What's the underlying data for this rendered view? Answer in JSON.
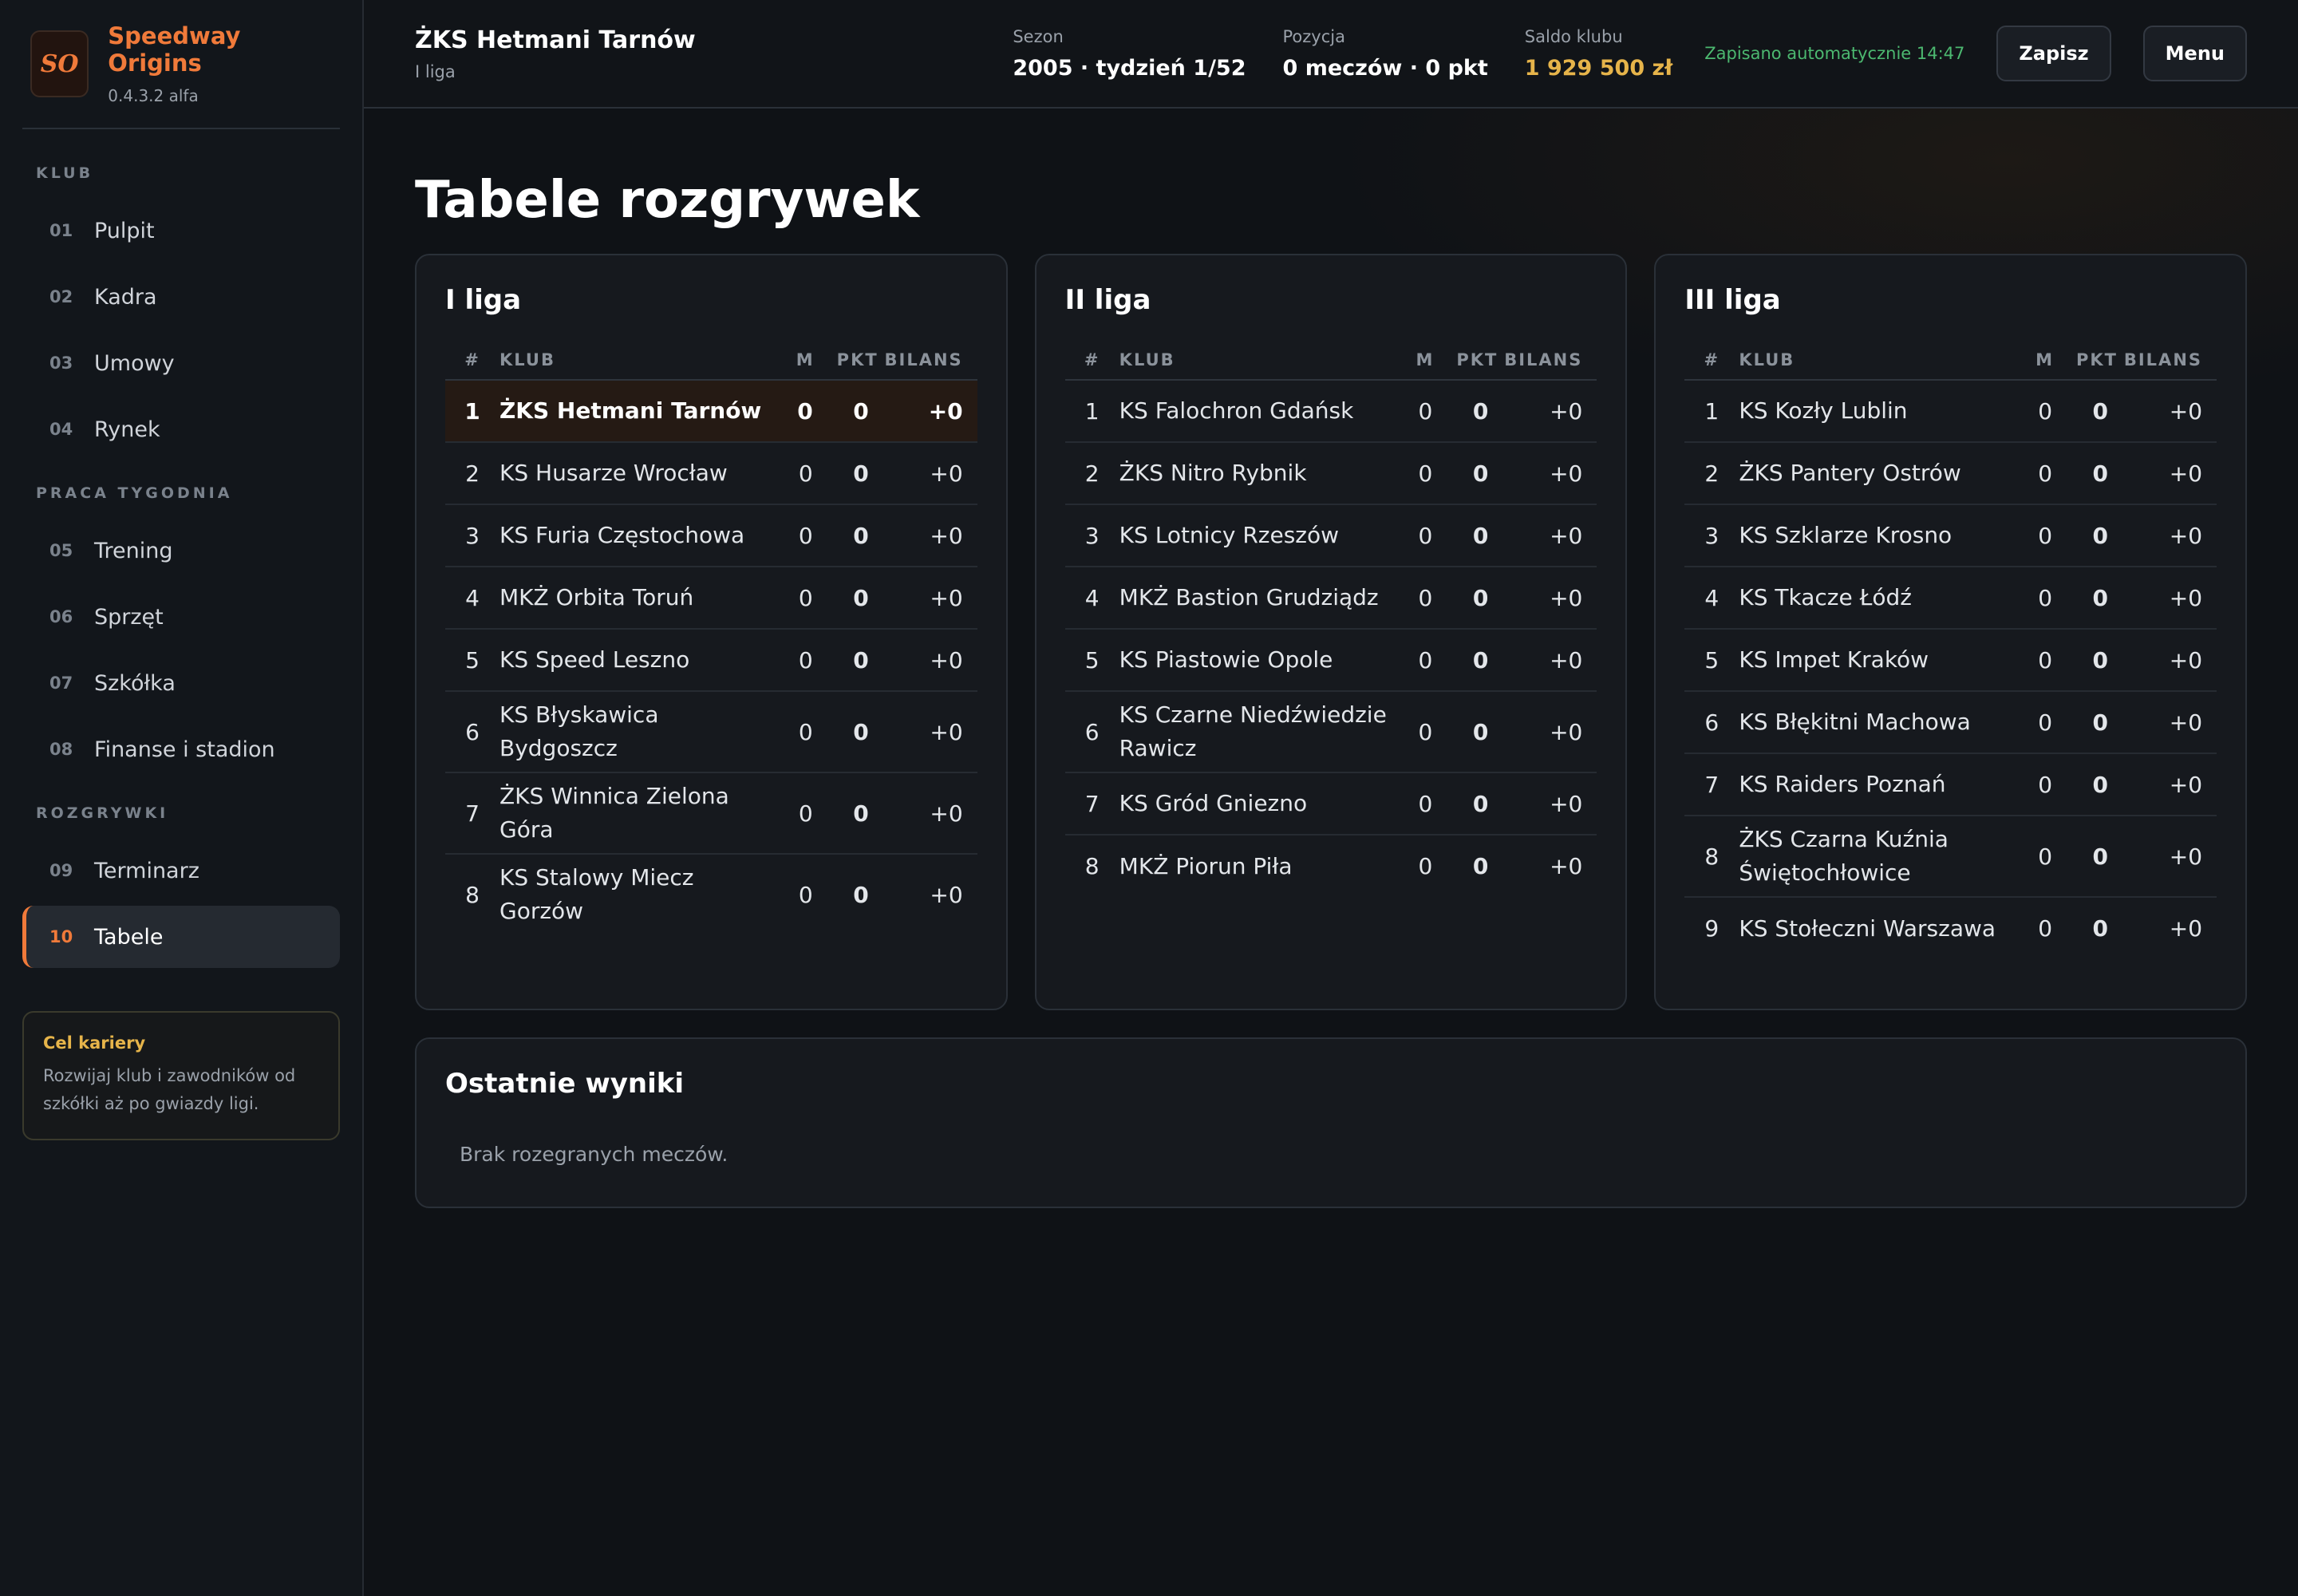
{
  "brand": {
    "logo": "SO",
    "name": "Speedway Origins",
    "version": "0.4.3.2 alfa"
  },
  "nav": [
    {
      "label": "KLUB",
      "items": [
        {
          "num": "01",
          "label": "Pulpit"
        },
        {
          "num": "02",
          "label": "Kadra"
        },
        {
          "num": "03",
          "label": "Umowy"
        },
        {
          "num": "04",
          "label": "Rynek"
        }
      ]
    },
    {
      "label": "PRACA TYGODNIA",
      "items": [
        {
          "num": "05",
          "label": "Trening"
        },
        {
          "num": "06",
          "label": "Sprzęt"
        },
        {
          "num": "07",
          "label": "Szkółka"
        },
        {
          "num": "08",
          "label": "Finanse i stadion"
        }
      ]
    },
    {
      "label": "ROZGRYWKI",
      "items": [
        {
          "num": "09",
          "label": "Terminarz"
        },
        {
          "num": "10",
          "label": "Tabele",
          "active": true
        }
      ]
    }
  ],
  "career": {
    "title": "Cel kariery",
    "text": "Rozwijaj klub i zawodników od szkółki aż po gwiazdy ligi."
  },
  "header": {
    "club_name": "ŻKS Hetmani Tarnów",
    "league": "I liga",
    "season_label": "Sezon",
    "season_value": "2005 · tydzień 1/52",
    "position_label": "Pozycja",
    "position_value": "0 meczów · 0 pkt",
    "balance_label": "Saldo klubu",
    "balance_value": "1 929 500 zł",
    "autosave": "Zapisano automatycznie 14:47",
    "save_button": "Zapisz",
    "menu_button": "Menu"
  },
  "page": {
    "title": "Tabele rozgrywek"
  },
  "table_headers": {
    "pos": "#",
    "club": "KLUB",
    "m": "M",
    "pkt": "PKT",
    "bilans": "BILANS"
  },
  "leagues": [
    {
      "name": "I liga",
      "rows": [
        {
          "pos": "1",
          "club": "ŻKS Hetmani Tarnów",
          "m": "0",
          "pkt": "0",
          "bilans": "+0",
          "highlight": true
        },
        {
          "pos": "2",
          "club": "KS Husarze Wrocław",
          "m": "0",
          "pkt": "0",
          "bilans": "+0"
        },
        {
          "pos": "3",
          "club": "KS Furia Częstochowa",
          "m": "0",
          "pkt": "0",
          "bilans": "+0"
        },
        {
          "pos": "4",
          "club": "MKŻ Orbita Toruń",
          "m": "0",
          "pkt": "0",
          "bilans": "+0"
        },
        {
          "pos": "5",
          "club": "KS Speed Leszno",
          "m": "0",
          "pkt": "0",
          "bilans": "+0"
        },
        {
          "pos": "6",
          "club": "KS Błyskawica Bydgoszcz",
          "m": "0",
          "pkt": "0",
          "bilans": "+0"
        },
        {
          "pos": "7",
          "club": "ŻKS Winnica Zielona Góra",
          "m": "0",
          "pkt": "0",
          "bilans": "+0"
        },
        {
          "pos": "8",
          "club": "KS Stalowy Miecz Gorzów",
          "m": "0",
          "pkt": "0",
          "bilans": "+0"
        }
      ]
    },
    {
      "name": "II liga",
      "rows": [
        {
          "pos": "1",
          "club": "KS Falochron Gdańsk",
          "m": "0",
          "pkt": "0",
          "bilans": "+0"
        },
        {
          "pos": "2",
          "club": "ŻKS Nitro Rybnik",
          "m": "0",
          "pkt": "0",
          "bilans": "+0"
        },
        {
          "pos": "3",
          "club": "KS Lotnicy Rzeszów",
          "m": "0",
          "pkt": "0",
          "bilans": "+0"
        },
        {
          "pos": "4",
          "club": "MKŻ Bastion Grudziądz",
          "m": "0",
          "pkt": "0",
          "bilans": "+0"
        },
        {
          "pos": "5",
          "club": "KS Piastowie Opole",
          "m": "0",
          "pkt": "0",
          "bilans": "+0"
        },
        {
          "pos": "6",
          "club": "KS Czarne Niedźwiedzie Rawicz",
          "m": "0",
          "pkt": "0",
          "bilans": "+0"
        },
        {
          "pos": "7",
          "club": "KS Gród Gniezno",
          "m": "0",
          "pkt": "0",
          "bilans": "+0"
        },
        {
          "pos": "8",
          "club": "MKŻ Piorun Piła",
          "m": "0",
          "pkt": "0",
          "bilans": "+0"
        }
      ]
    },
    {
      "name": "III liga",
      "rows": [
        {
          "pos": "1",
          "club": "KS Kozły Lublin",
          "m": "0",
          "pkt": "0",
          "bilans": "+0"
        },
        {
          "pos": "2",
          "club": "ŻKS Pantery Ostrów",
          "m": "0",
          "pkt": "0",
          "bilans": "+0"
        },
        {
          "pos": "3",
          "club": "KS Szklarze Krosno",
          "m": "0",
          "pkt": "0",
          "bilans": "+0"
        },
        {
          "pos": "4",
          "club": "KS Tkacze Łódź",
          "m": "0",
          "pkt": "0",
          "bilans": "+0"
        },
        {
          "pos": "5",
          "club": "KS Impet Kraków",
          "m": "0",
          "pkt": "0",
          "bilans": "+0"
        },
        {
          "pos": "6",
          "club": "KS Błękitni Machowa",
          "m": "0",
          "pkt": "0",
          "bilans": "+0"
        },
        {
          "pos": "7",
          "club": "KS Raiders Poznań",
          "m": "0",
          "pkt": "0",
          "bilans": "+0"
        },
        {
          "pos": "8",
          "club": "ŻKS Czarna Kuźnia Świętochłowice",
          "m": "0",
          "pkt": "0",
          "bilans": "+0"
        },
        {
          "pos": "9",
          "club": "KS Stołeczni Warszawa",
          "m": "0",
          "pkt": "0",
          "bilans": "+0"
        }
      ]
    }
  ],
  "results": {
    "title": "Ostatnie wyniki",
    "empty": "Brak rozegranych meczów."
  },
  "colors": {
    "accent": "#f07a3a",
    "money": "#e6b44a",
    "autosave": "#4cb870",
    "highlight_row": "#251a14"
  }
}
